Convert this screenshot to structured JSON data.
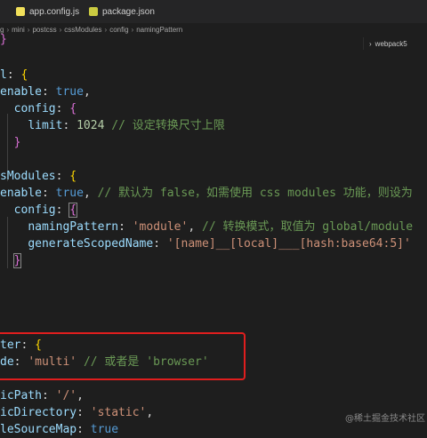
{
  "tabs": [
    {
      "label": "app.config.js",
      "icon": "javascript-file-icon",
      "color": "#f1e05a"
    },
    {
      "label": "package.json",
      "icon": "json-file-icon",
      "color": "#cbcb41"
    }
  ],
  "breadcrumb": [
    "g",
    "mini",
    "postcss",
    "cssModules",
    "config",
    "namingPattern"
  ],
  "outline_label": "webpack5",
  "code": {
    "l1": "}",
    "l2_key": "l",
    "l3_key": "enable",
    "l3_val": "true",
    "l4_key": "config",
    "l5_key": "limit",
    "l5_val": "1024",
    "l5_cmt": "// 设定转换尺寸上限",
    "l6": "}",
    "l8_key": "sModules",
    "l9_key": "enable",
    "l9_val": "true",
    "l9_cmt": "// 默认为 false，如需使用 css modules 功能，则设为",
    "l10_key": "config",
    "l11_key": "namingPattern",
    "l11_val": "'module'",
    "l11_cmt": "// 转换模式，取值为 global/module",
    "l12_key": "generateScopedName",
    "l12_val": "'[name]__[local]___[hash:base64:5]'",
    "l13": "}",
    "l18_key": "ter",
    "l19_key": "de",
    "l19_val": "'multi'",
    "l19_cmt": "// 或者是 'browser'",
    "l21_key": "icPath",
    "l21_val": "'/'",
    "l22_key": "icDirectory",
    "l22_val": "'static'",
    "l23_key": "leSourceMap",
    "l23_val": "true"
  },
  "watermark": "@稀土掘金技术社区"
}
